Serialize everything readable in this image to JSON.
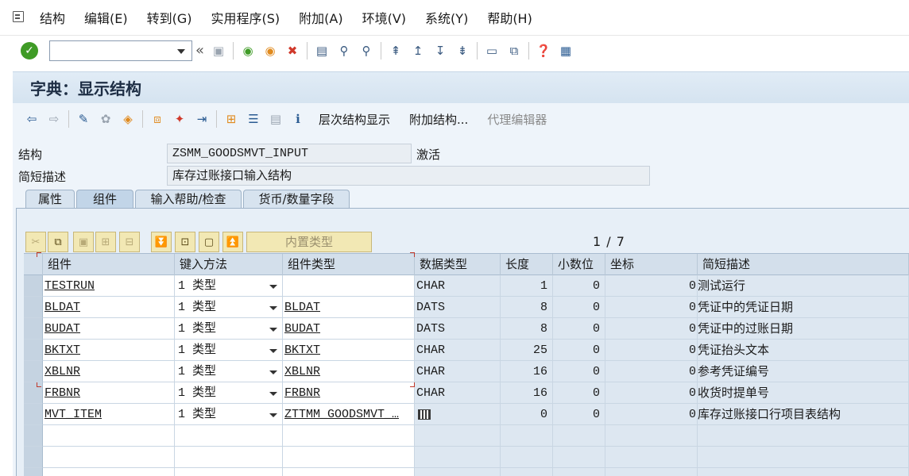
{
  "menu": {
    "items": [
      "结构",
      "编辑(E)",
      "转到(G)",
      "实用程序(S)",
      "附加(A)",
      "环境(V)",
      "系统(Y)",
      "帮助(H)"
    ]
  },
  "toolbar": {
    "command_value": "",
    "back_glyph": "«"
  },
  "title": "字典：显示结构",
  "app_toolbar": {
    "hierarchy_label": "层次结构显示",
    "append_label": "附加结构...",
    "proxy_label": "代理编辑器"
  },
  "form": {
    "structure_label": "结构",
    "structure_value": "ZSMM_GOODSMVT_INPUT",
    "status": "激活",
    "short_desc_label": "简短描述",
    "short_desc_value": "库存过账接口输入结构"
  },
  "tabs": [
    "属性",
    "组件",
    "输入帮助/检查",
    "货币/数量字段"
  ],
  "grid": {
    "builtin_type_label": "内置类型",
    "pager": "1 / 7",
    "columns": [
      "组件",
      "键入方法",
      "组件类型",
      "数据类型",
      "长度",
      "小数位",
      "坐标",
      "简短描述"
    ],
    "rows": [
      {
        "component": "TESTRUN",
        "typing": "1 类型",
        "comp_type": "",
        "data_type": "CHAR",
        "length": "1",
        "decimals": "0",
        "coord": "0",
        "desc": "测试运行"
      },
      {
        "component": "BLDAT",
        "typing": "1 类型",
        "comp_type": "BLDAT",
        "data_type": "DATS",
        "length": "8",
        "decimals": "0",
        "coord": "0",
        "desc": "凭证中的凭证日期"
      },
      {
        "component": "BUDAT",
        "typing": "1 类型",
        "comp_type": "BUDAT",
        "data_type": "DATS",
        "length": "8",
        "decimals": "0",
        "coord": "0",
        "desc": "凭证中的过账日期"
      },
      {
        "component": "BKTXT",
        "typing": "1 类型",
        "comp_type": "BKTXT",
        "data_type": "CHAR",
        "length": "25",
        "decimals": "0",
        "coord": "0",
        "desc": "凭证抬头文本"
      },
      {
        "component": "XBLNR",
        "typing": "1 类型",
        "comp_type": "XBLNR",
        "data_type": "CHAR",
        "length": "16",
        "decimals": "0",
        "coord": "0",
        "desc": "参考凭证编号"
      },
      {
        "component": "FRBNR",
        "typing": "1 类型",
        "comp_type": "FRBNR",
        "data_type": "CHAR",
        "length": "16",
        "decimals": "0",
        "coord": "0",
        "desc": "收货时提单号"
      },
      {
        "component": "MVT_ITEM",
        "typing": "1 类型",
        "comp_type": "ZTTMM_GOODSMVT_…",
        "data_type": "",
        "length": "0",
        "decimals": "0",
        "coord": "0",
        "desc": "库存过账接口行项目表结构"
      }
    ]
  }
}
